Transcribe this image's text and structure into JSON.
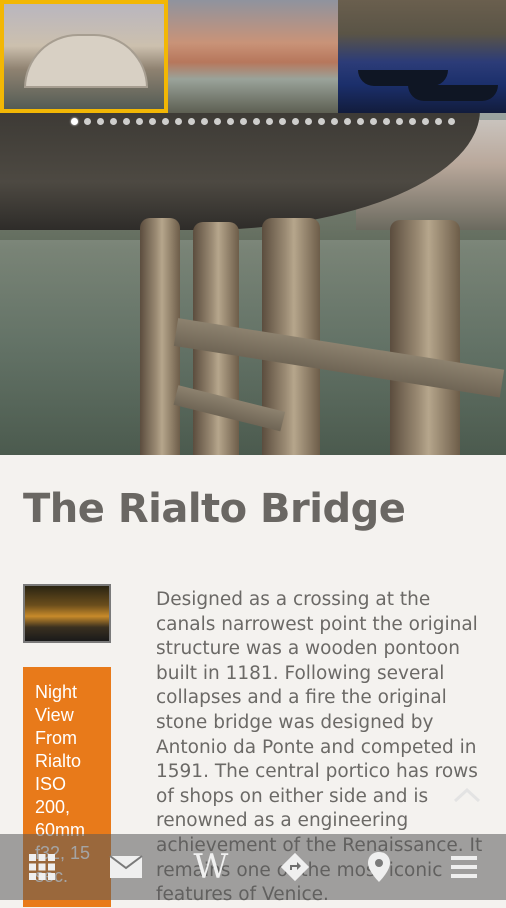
{
  "hero": {
    "thumbnails": [
      {
        "subject": "rialto-bridge-day",
        "selected": true
      },
      {
        "subject": "grand-canal-buildings",
        "selected": false
      },
      {
        "subject": "gondolas",
        "selected": false
      }
    ],
    "page_dots_count": 30,
    "active_dot_index": 0,
    "accent_color": "#f2b705"
  },
  "article": {
    "title": "The Rialto Bridge",
    "caption": "Night View From Rialto ISO 200, 60mm f32, 15 sec.",
    "body": "Designed as a crossing at the canals narrowest point the original structure was a wooden pontoon built in 1181. Following several collapses and a fire the original stone bridge was designed by Antonio da Ponte and competed in 1591. The central portico has rows of shops on either side and is renowned as a engineering achievement of the Renaissance. It remains one of the most iconic features of Venice."
  },
  "colors": {
    "caption_bg": "#e87a1a",
    "title_color": "#6a6763",
    "text_color": "#6b6966"
  },
  "toolbar": {
    "items": [
      {
        "icon": "grid-icon"
      },
      {
        "icon": "mail-icon"
      },
      {
        "icon": "wikipedia-icon",
        "glyph": "W"
      },
      {
        "icon": "directions-icon"
      },
      {
        "icon": "map-pin-icon"
      },
      {
        "icon": "menu-icon"
      }
    ]
  }
}
